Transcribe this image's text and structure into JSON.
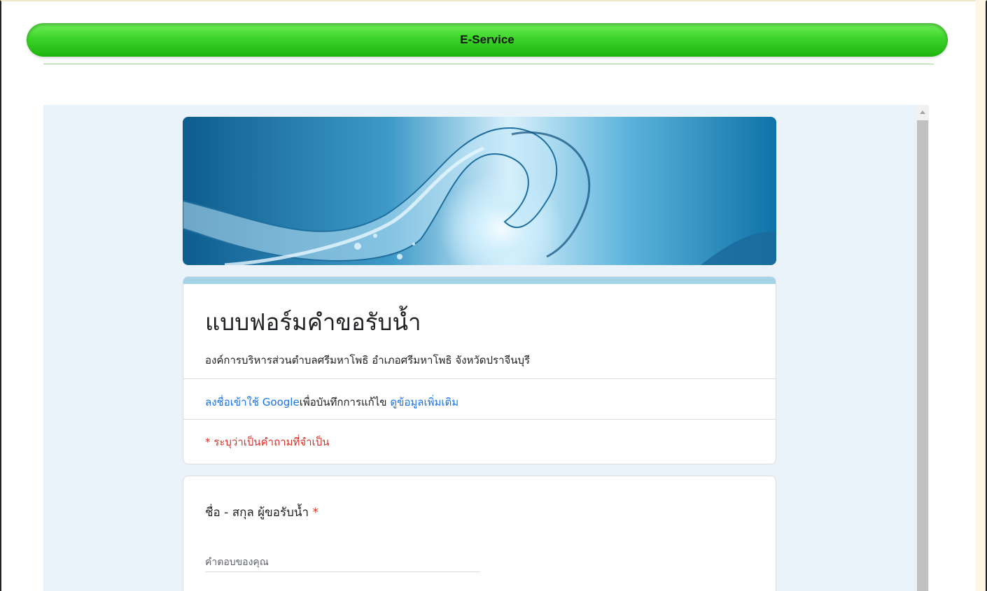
{
  "banner": {
    "title": "E-Service"
  },
  "form": {
    "title": "แบบฟอร์มคำขอรับน้ำ",
    "description": "องค์การบริหารส่วนตำบลศรีมหาโพธิ อำเภอศรีมหาโพธิ จังหวัดปราจีนบุรี",
    "signin_link": "ลงชื่อเข้าใช้ Google",
    "signin_text": "เพื่อบันทึกการแก้ไข",
    "learn_more": "ดูข้อมูลเพิ่มเติม",
    "required_note": "* ระบุว่าเป็นคำถามที่จำเป็น",
    "questions": [
      {
        "label": "ชื่อ - สกุล ผู้ขอรับน้ำ",
        "required_mark": "*",
        "placeholder": "คำตอบของคุณ"
      }
    ]
  },
  "colors": {
    "banner_green": "#3dd42a",
    "page_background": "#eaf3fa",
    "accent": "#a4d2e6",
    "link": "#1a73e8",
    "required": "#d93025"
  },
  "icons": {
    "header_image": "water-splash-image",
    "scroll_up": "triangle-up-icon"
  }
}
